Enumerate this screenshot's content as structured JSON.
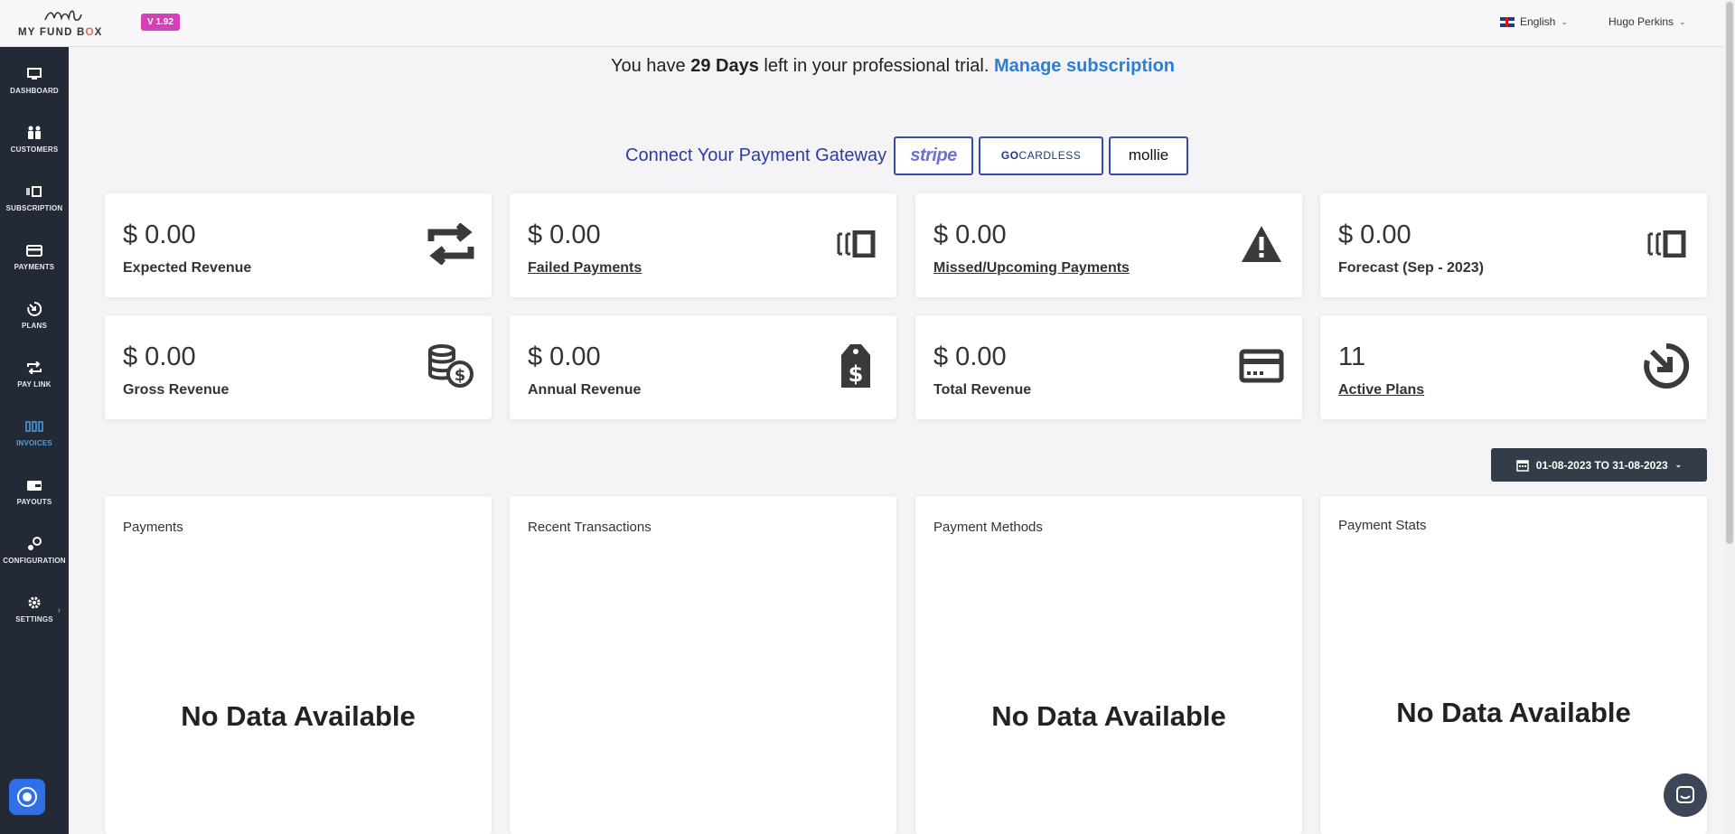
{
  "header": {
    "logo_text_pre": "MY FUND B",
    "logo_text_o": "O",
    "logo_text_post": "X",
    "version": "V 1.92",
    "language": "English",
    "user_name": "Hugo Perkins"
  },
  "sidebar": {
    "items": [
      {
        "label": "DASHBOARD",
        "icon": "monitor-icon"
      },
      {
        "label": "CUSTOMERS",
        "icon": "users-icon"
      },
      {
        "label": "SUBSCRIPTION",
        "icon": "subscription-icon"
      },
      {
        "label": "PAYMENTS",
        "icon": "credit-card-icon"
      },
      {
        "label": "PLANS",
        "icon": "plans-icon"
      },
      {
        "label": "PAY LINK",
        "icon": "repeat-icon"
      },
      {
        "label": "INVOICES",
        "icon": "invoices-icon",
        "active": true
      },
      {
        "label": "PAYOUTS",
        "icon": "wallet-icon"
      },
      {
        "label": "CONFIGURATION",
        "icon": "configuration-icon"
      },
      {
        "label": "SETTINGS",
        "icon": "gear-icon"
      }
    ]
  },
  "trial": {
    "prefix": "You have ",
    "days": "29 Days",
    "suffix": " left in your professional trial. ",
    "link": "Manage subscription"
  },
  "gateway": {
    "label": "Connect Your Payment Gateway",
    "stripe": "stripe",
    "gocardless_go": "GO",
    "gocardless_rest": "CARDLESS",
    "mollie": "mollie"
  },
  "cards": [
    {
      "amount": "$ 0.00",
      "label": "Expected Revenue",
      "icon": "repeat-icon"
    },
    {
      "amount": "$ 0.00",
      "label": "Failed Payments",
      "icon": "subscription-icon"
    },
    {
      "amount": "$ 0.00",
      "label": "Missed/Upcoming Payments",
      "icon": "warning-icon"
    },
    {
      "amount": "$ 0.00",
      "label": "Forecast (Sep - 2023)",
      "icon": "subscription-icon"
    },
    {
      "amount": "$ 0.00",
      "label": "Gross Revenue",
      "icon": "coins-icon"
    },
    {
      "amount": "$ 0.00",
      "label": "Annual Revenue",
      "icon": "price-tag-icon"
    },
    {
      "amount": "$ 0.00",
      "label": "Total Revenue",
      "icon": "credit-card-icon"
    },
    {
      "amount": "11",
      "label": "Active Plans",
      "icon": "plans-icon"
    }
  ],
  "date_range": "01-08-2023 TO 31-08-2023",
  "panels": [
    {
      "title": "Payments",
      "empty": "No Data Available"
    },
    {
      "title": "Recent Transactions",
      "empty": ""
    },
    {
      "title": "Payment Methods",
      "empty": "No Data Available"
    },
    {
      "title": "Payment Stats",
      "empty": "No Data Available"
    }
  ],
  "colors": {
    "sidebar_bg": "#232a35",
    "accent_blue": "#2a7fd4",
    "version_badge": "#d63fb8",
    "gateway_blue": "#2a3ca8"
  }
}
